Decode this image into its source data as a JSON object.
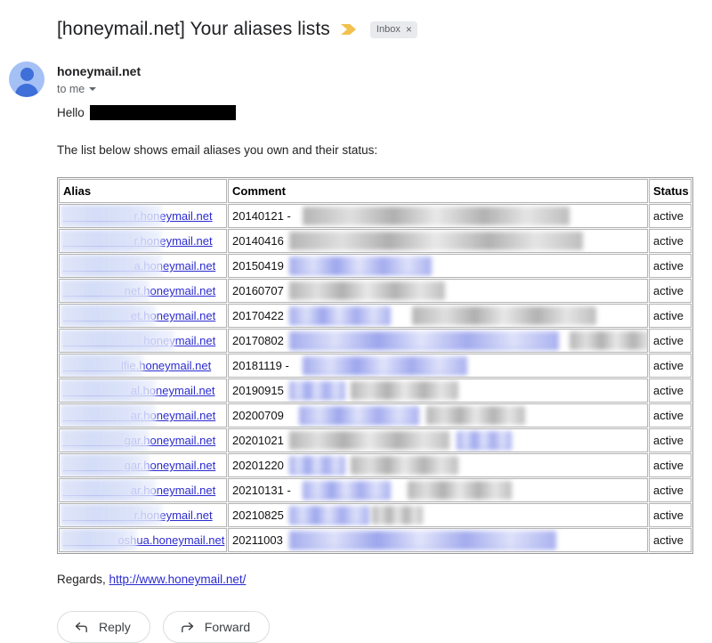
{
  "email": {
    "subject": "[honeymail.net] Your aliases lists",
    "important_marker_icon": "important-marker-icon",
    "label_chip": {
      "text": "Inbox",
      "remove": "×"
    },
    "sender": {
      "avatar_icon": "person-avatar-icon",
      "name": "honeymail.net",
      "recipient": "to me",
      "expand_icon": "chevron-down-icon"
    },
    "body": {
      "greeting": "Hello",
      "greeting_redacted": true,
      "intro": "The list below shows email aliases you own and their status:",
      "regards_prefix": "Regards,",
      "regards_link": "http://www.honeymail.net/"
    }
  },
  "table": {
    "headers": [
      "Alias",
      "Comment",
      "Status"
    ],
    "rows": [
      {
        "alias_redacted": "",
        "alias_visible": "r.honeymail.net",
        "date": "20140121 -",
        "comment_redacted": true,
        "comment_style": "gray",
        "comment_width": 300,
        "status": "active"
      },
      {
        "alias_redacted": "",
        "alias_visible": "r.honeymail.net",
        "date": "20140416",
        "comment_redacted": true,
        "comment_style": "gray",
        "comment_width": 330,
        "status": "active"
      },
      {
        "alias_redacted": "",
        "alias_visible": "a.honeymail.net",
        "date": "20150419",
        "comment_redacted": true,
        "comment_style": "blue",
        "comment_width": 160,
        "status": "active"
      },
      {
        "alias_redacted": "",
        "alias_visible": "net.honeymail.net",
        "date": "20160707",
        "comment_redacted": true,
        "comment_style": "gray",
        "comment_width": 175,
        "status": "active"
      },
      {
        "alias_redacted": "",
        "alias_visible": "et.honeymail.net",
        "date": "20170422",
        "comment_redacted": true,
        "comment_style": "mixed",
        "comment_width": 345,
        "status": "active"
      },
      {
        "alias_redacted": "",
        "alias_visible": "honeymail.net",
        "date": "20170802",
        "comment_redacted": true,
        "comment_style": "mixed2",
        "comment_width": 420,
        "status": "active"
      },
      {
        "alias_redacted": "",
        "alias_visible": "lfie.honeymail.net",
        "date": "20181119 -",
        "comment_redacted": true,
        "comment_style": "blue",
        "comment_width": 185,
        "status": "active"
      },
      {
        "alias_redacted": "",
        "alias_visible": "al.honeymail.net",
        "date": "20190915",
        "comment_redacted": true,
        "comment_style": "mixed3",
        "comment_width": 190,
        "status": "active"
      },
      {
        "alias_redacted": "",
        "alias_visible": "ar.honeymail.net",
        "date": "20200709",
        "comment_redacted": true,
        "comment_style": "mixed4",
        "comment_width": 265,
        "status": "active"
      },
      {
        "alias_redacted": "",
        "alias_visible": "gar.honeymail.net",
        "date": "20201021",
        "comment_redacted": true,
        "comment_style": "mixed5",
        "comment_width": 250,
        "status": "active"
      },
      {
        "alias_redacted": "",
        "alias_visible": "gar.honeymail.net",
        "date": "20201220",
        "comment_redacted": true,
        "comment_style": "mixed3",
        "comment_width": 190,
        "status": "active"
      },
      {
        "alias_redacted": "",
        "alias_visible": "ar.honeymail.net",
        "date": "20210131 -",
        "comment_redacted": true,
        "comment_style": "mixed6",
        "comment_width": 235,
        "status": "active"
      },
      {
        "alias_redacted": "",
        "alias_visible": "r.honeymail.net",
        "date": "20210825",
        "comment_redacted": true,
        "comment_style": "mixed7",
        "comment_width": 150,
        "status": "active"
      },
      {
        "alias_redacted": "",
        "alias_visible": "oshua.honeymail.net",
        "date": "20211003",
        "comment_redacted": true,
        "comment_style": "blue",
        "comment_width": 300,
        "status": "active"
      }
    ]
  },
  "actions": {
    "reply": {
      "label": "Reply",
      "icon": "reply-arrow-icon"
    },
    "forward": {
      "label": "Forward",
      "icon": "forward-arrow-icon"
    }
  },
  "colors": {
    "link": "#2b2bd0",
    "important_marker": "#f2c14e",
    "chip_bg": "#e8eaed",
    "avatar_bg": "#a5c0f5",
    "avatar_fg": "#3f6fd8"
  }
}
